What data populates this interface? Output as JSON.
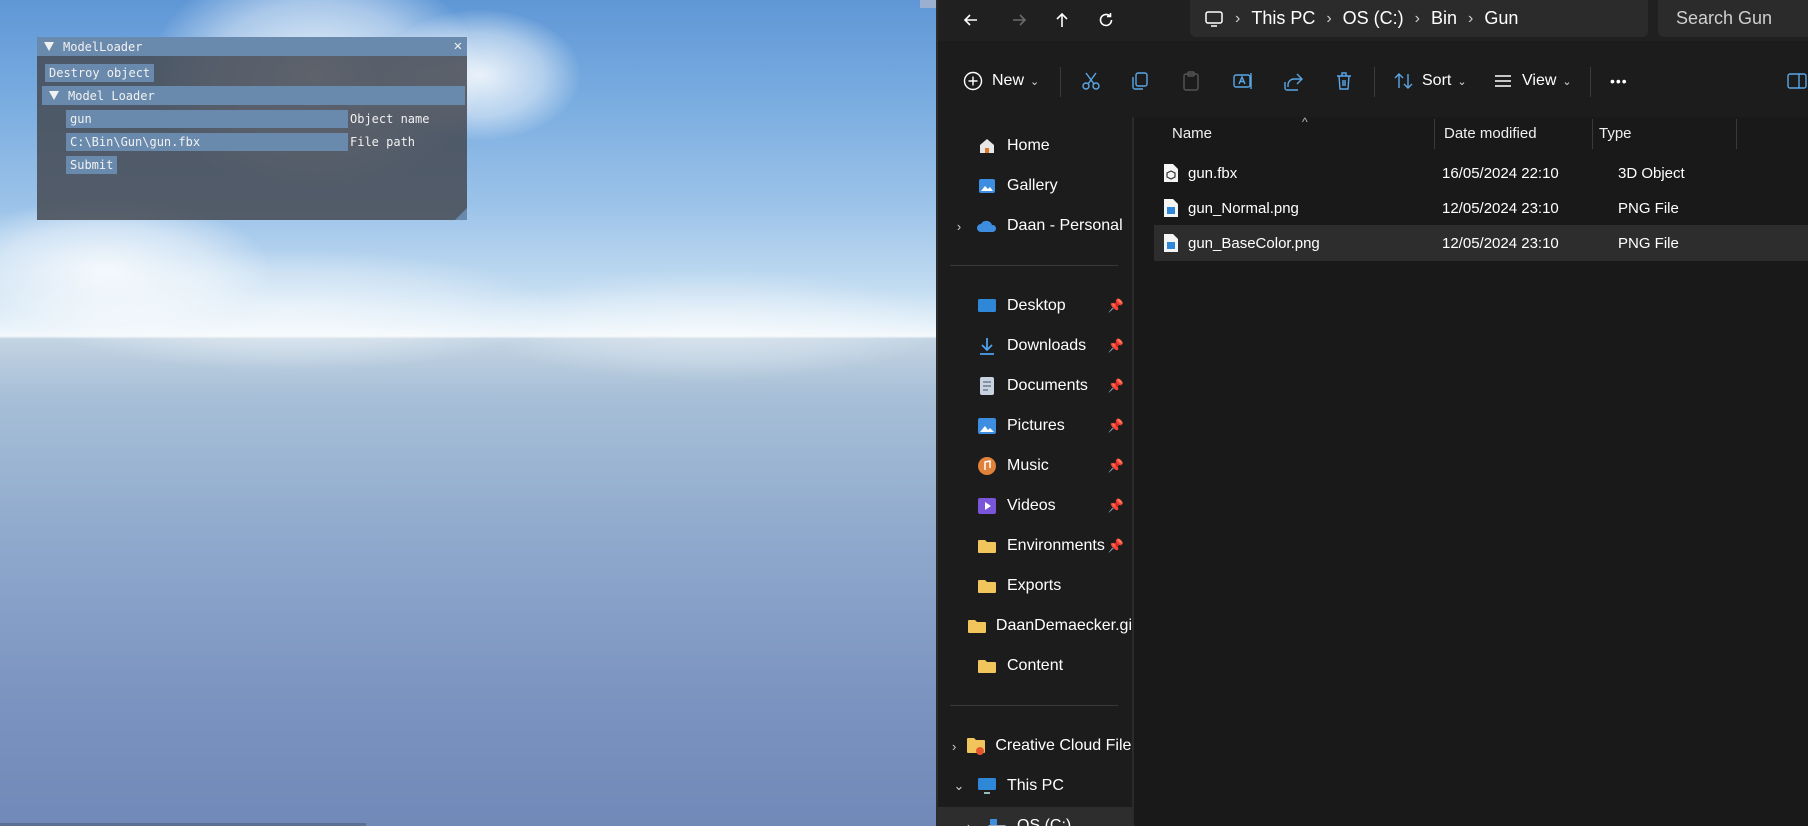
{
  "imgui": {
    "title": "ModelLoader",
    "close_glyph": "✕",
    "destroy_button": "Destroy object",
    "section_header": "Model Loader",
    "object_name_value": "gun",
    "object_name_label": "Object name",
    "file_path_value": "C:\\Bin\\Gun\\gun.fbx",
    "file_path_label": "File path",
    "submit_button": "Submit"
  },
  "explorer": {
    "breadcrumb": [
      "This PC",
      "OS (C:)",
      "Bin",
      "Gun"
    ],
    "search_placeholder": "Search Gun",
    "commands": {
      "new": "New",
      "sort": "Sort",
      "view": "View",
      "more": "•••"
    },
    "nav_top": [
      {
        "label": "Home",
        "icon": "home-icon"
      },
      {
        "label": "Gallery",
        "icon": "gallery-icon"
      },
      {
        "label": "Daan - Personal",
        "icon": "onedrive-icon",
        "expandable": true
      }
    ],
    "nav_quick": [
      {
        "label": "Desktop",
        "icon": "desktop-icon",
        "pinned": true
      },
      {
        "label": "Downloads",
        "icon": "downloads-icon",
        "pinned": true
      },
      {
        "label": "Documents",
        "icon": "documents-icon",
        "pinned": true
      },
      {
        "label": "Pictures",
        "icon": "pictures-icon",
        "pinned": true
      },
      {
        "label": "Music",
        "icon": "music-icon",
        "pinned": true
      },
      {
        "label": "Videos",
        "icon": "videos-icon",
        "pinned": true
      },
      {
        "label": "Environments",
        "icon": "folder-icon",
        "pinned": true
      },
      {
        "label": "Exports",
        "icon": "folder-icon",
        "pinned": false
      },
      {
        "label": "DaanDemaecker.gi",
        "icon": "folder-icon",
        "pinned": false
      },
      {
        "label": "Content",
        "icon": "folder-icon",
        "pinned": false
      }
    ],
    "nav_bottom": [
      {
        "label": "Creative Cloud Files",
        "icon": "creative-cloud-icon",
        "expander": "›"
      },
      {
        "label": "This PC",
        "icon": "this-pc-icon",
        "expander": "⌄"
      },
      {
        "label": "OS (C:)",
        "icon": "drive-icon",
        "expander": "›"
      }
    ],
    "columns": {
      "name": "Name",
      "date": "Date modified",
      "type": "Type"
    },
    "files": [
      {
        "name": "gun.fbx",
        "date": "16/05/2024 22:10",
        "type": "3D Object",
        "icon": "3d-object-file-icon"
      },
      {
        "name": "gun_Normal.png",
        "date": "12/05/2024 23:10",
        "type": "PNG File",
        "icon": "png-file-icon"
      },
      {
        "name": "gun_BaseColor.png",
        "date": "12/05/2024 23:10",
        "type": "PNG File",
        "icon": "png-file-icon",
        "selected": true
      }
    ]
  }
}
